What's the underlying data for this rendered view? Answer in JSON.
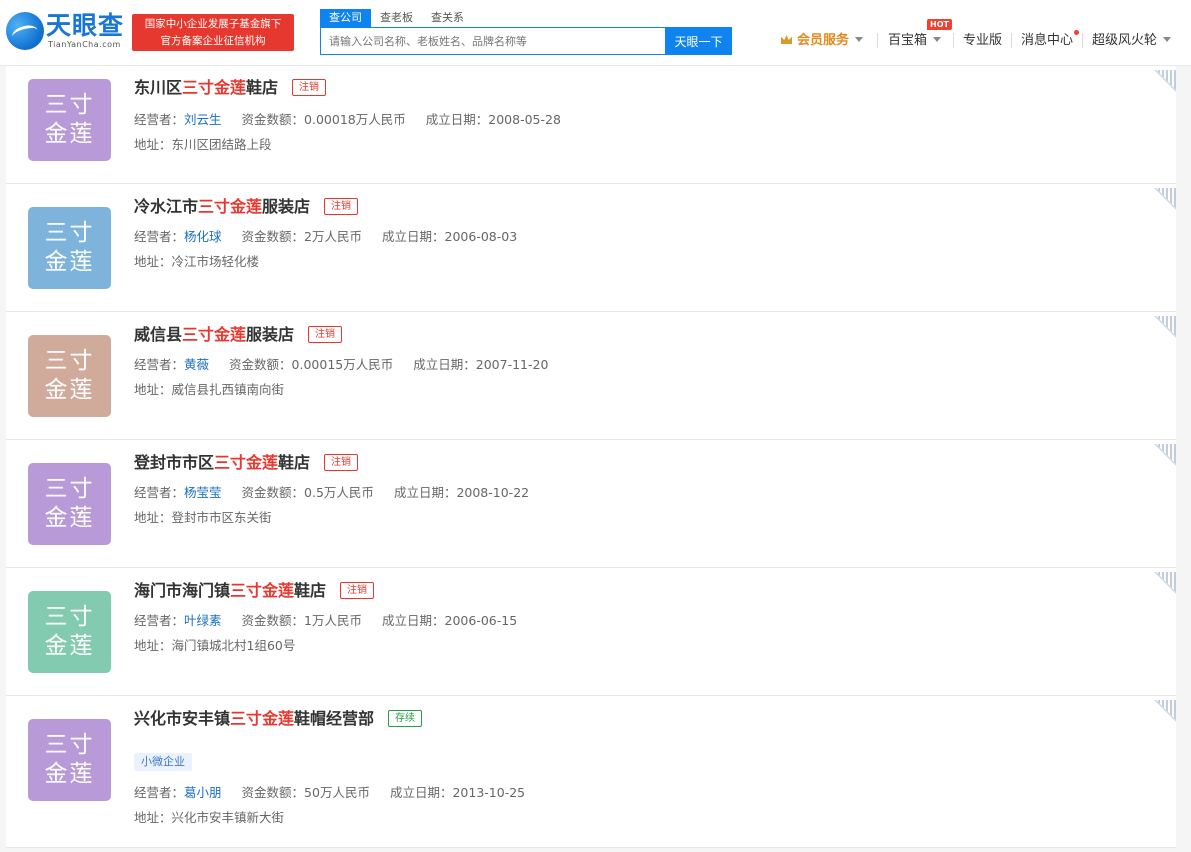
{
  "header": {
    "logo_text": "天眼查",
    "logo_sub": "TianYanCha.com",
    "slogan_line1": "国家中小企业发展子基金旗下",
    "slogan_line2": "官方备案企业征信机构",
    "search_tabs": [
      "查公司",
      "查老板",
      "查关系"
    ],
    "search_placeholder": "请输入公司名称、老板姓名、品牌名称等",
    "search_button": "天眼一下",
    "nav": {
      "vip": "会员服务",
      "baibaoxiang": "百宝箱",
      "hot_badge": "HOT",
      "pro": "专业版",
      "messages": "消息中心",
      "user": "超级风火轮"
    }
  },
  "avatar_text": [
    "三寸",
    "金莲"
  ],
  "labels": {
    "operator": "经营者：",
    "capital": "资金数额：",
    "founded": "成立日期：",
    "address": "地址："
  },
  "results": [
    {
      "name_pre": "东川区",
      "name_hl": "三寸金莲",
      "name_post": "鞋店",
      "status": "注销",
      "operator": "刘云生",
      "capital": "0.00018万人民币",
      "founded": "2008-05-28",
      "address": "东川区团结路上段",
      "color": "#b99ad8"
    },
    {
      "name_pre": "冷水江市",
      "name_hl": "三寸金莲",
      "name_post": "服装店",
      "status": "注销",
      "operator": "杨化球",
      "capital": "2万人民币",
      "founded": "2006-08-03",
      "address": "冷江市场轻化楼",
      "color": "#7eb4dc"
    },
    {
      "name_pre": "威信县",
      "name_hl": "三寸金莲",
      "name_post": "服装店",
      "status": "注销",
      "operator": "黄薇",
      "capital": "0.00015万人民币",
      "founded": "2007-11-20",
      "address": "威信县扎西镇南向街",
      "color": "#d0ab9b"
    },
    {
      "name_pre": "登封市市区",
      "name_hl": "三寸金莲",
      "name_post": "鞋店",
      "status": "注销",
      "operator": "杨莹莹",
      "capital": "0.5万人民币",
      "founded": "2008-10-22",
      "address": "登封市市区东关街",
      "color": "#b99ad8"
    },
    {
      "name_pre": "海门市海门镇",
      "name_hl": "三寸金莲",
      "name_post": "鞋店",
      "status": "注销",
      "operator": "叶绿素",
      "capital": "1万人民币",
      "founded": "2006-06-15",
      "address": "海门镇城北村1组60号",
      "color": "#82cbb0"
    },
    {
      "name_pre": "兴化市安丰镇",
      "name_hl": "三寸金莲",
      "name_post": "鞋帽经营部",
      "status": "存续",
      "tag": "小微企业",
      "operator": "葛小朋",
      "capital": "50万人民币",
      "founded": "2013-10-25",
      "address": "兴化市安丰镇新大街",
      "color": "#b99ad8"
    }
  ]
}
